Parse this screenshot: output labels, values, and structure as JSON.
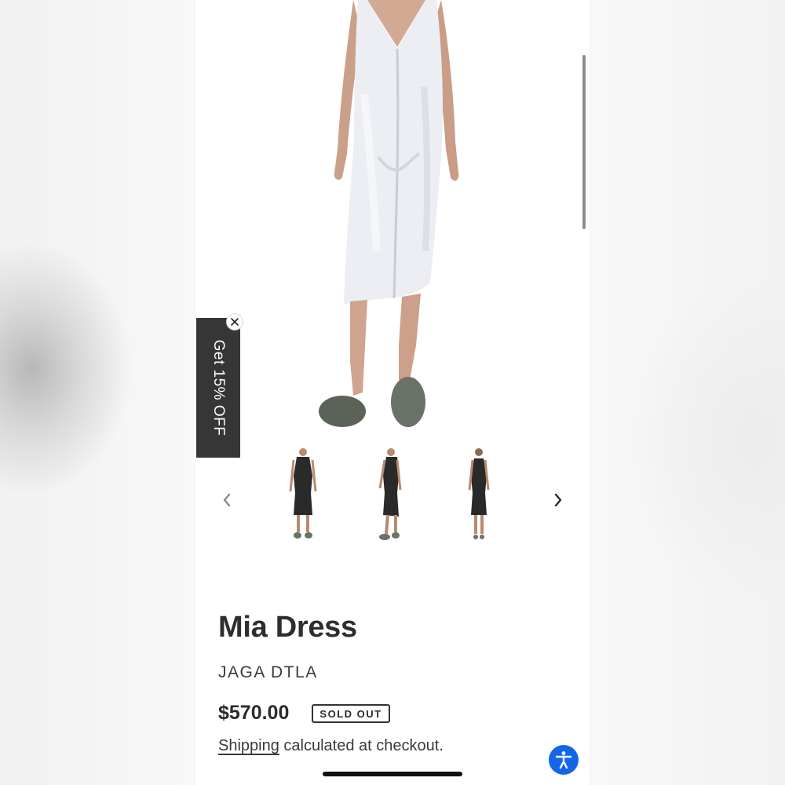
{
  "product": {
    "title": "Mia Dress",
    "vendor": "JAGA DTLA",
    "price": "$570.00",
    "badge": "SOLD OUT",
    "shipping_link": "Shipping",
    "shipping_rest": " calculated at checkout."
  },
  "promo": {
    "label": "Get 15% OFF",
    "close_icon": "close-icon"
  },
  "gallery": {
    "prev_icon": "chevron-left-icon",
    "next_icon": "chevron-right-icon",
    "thumbnails": [
      "front-view",
      "side-view",
      "back-view"
    ]
  },
  "accessibility": {
    "icon": "accessibility-icon",
    "color": "#1565e8"
  }
}
